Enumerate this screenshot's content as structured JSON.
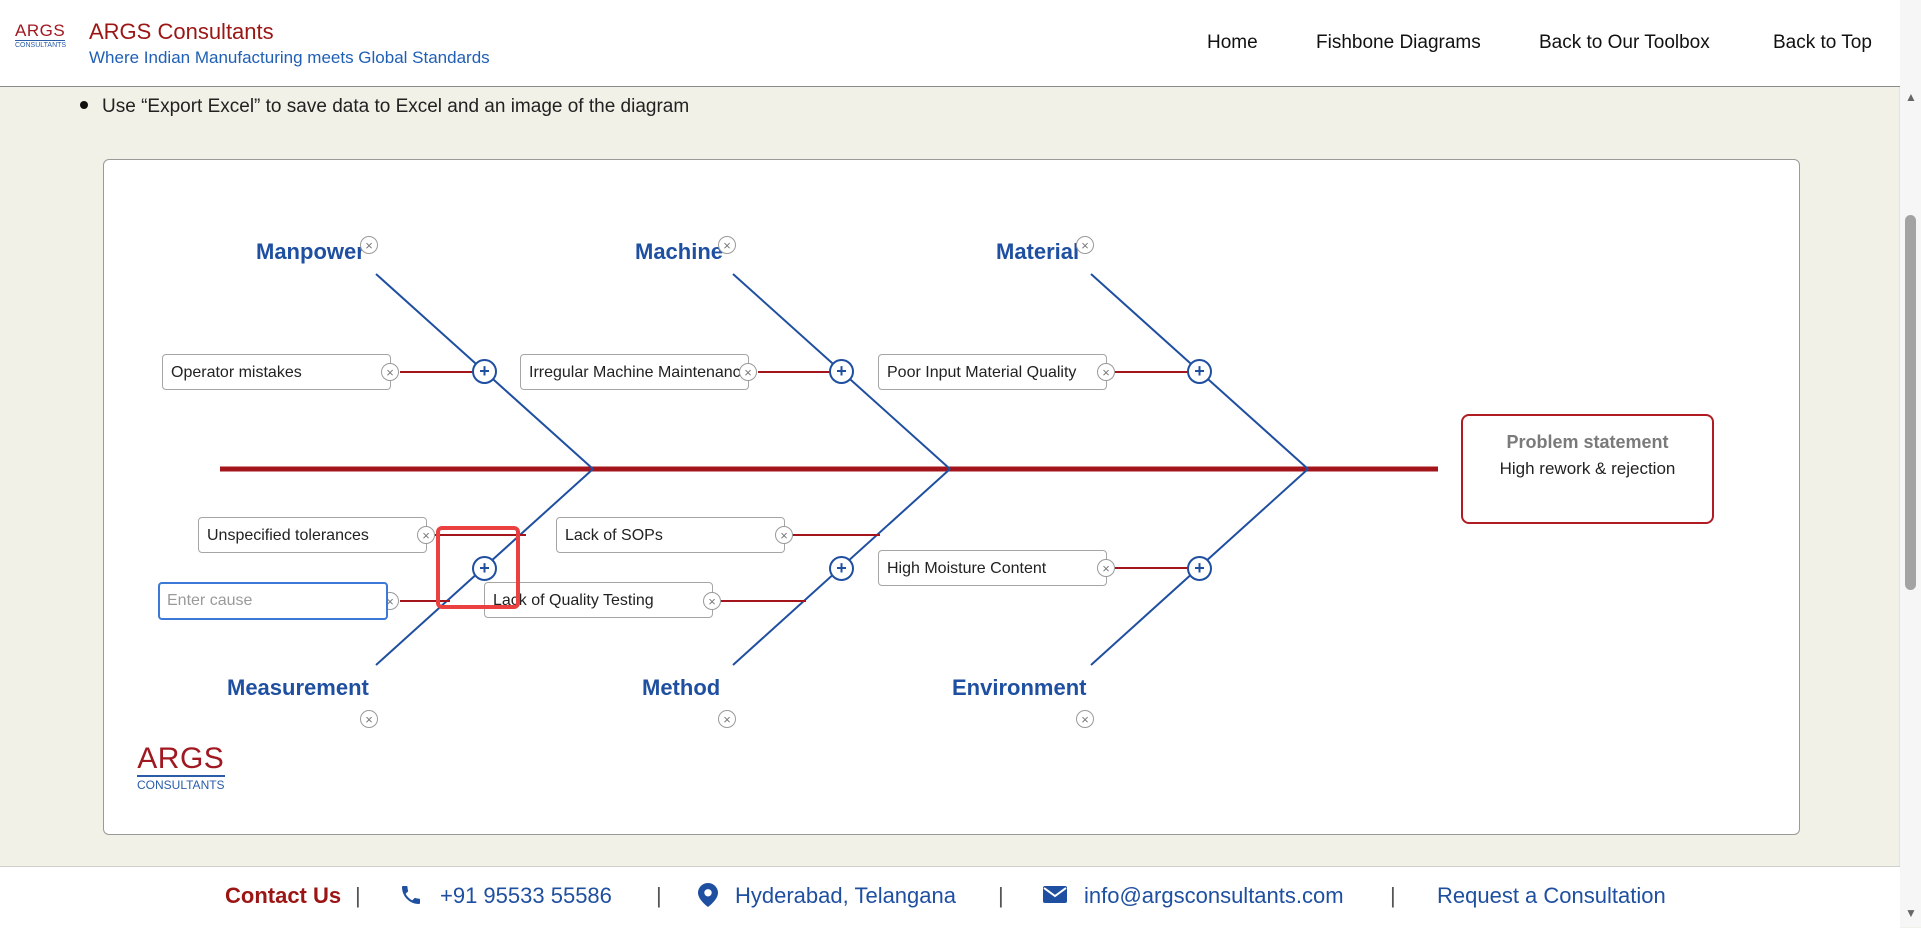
{
  "header": {
    "logo_top": "ARGS",
    "logo_bottom": "CONSULTANTS",
    "brand": "ARGS Consultants",
    "tagline": "Where Indian Manufacturing meets Global Standards",
    "nav": [
      "Home",
      "Fishbone Diagrams",
      "Back to Our Toolbox",
      "Back to Top"
    ]
  },
  "instructions": {
    "export_hint": "Use “Export Excel” to save data to Excel and an image of the diagram"
  },
  "diagram": {
    "categories": {
      "manpower": "Manpower",
      "machine": "Machine",
      "material": "Material",
      "measurement": "Measurement",
      "method": "Method",
      "environment": "Environment"
    },
    "causes": {
      "manpower_1": "Operator mistakes",
      "machine_1": "Irregular Machine Maintenance",
      "material_1": "Poor Input Material Quality",
      "measurement_1": "Unspecified tolerances",
      "method_1": "Lack of SOPs",
      "method_2": "Lack of Quality Testing",
      "environment_1": "High Moisture Content"
    },
    "new_cause_placeholder": "Enter cause",
    "problem_title": "Problem statement",
    "problem_text": "High rework & rejection",
    "watermark_top": "ARGS",
    "watermark_bottom": "CONSULTANTS",
    "icons": {
      "delete": "×",
      "add": "+"
    },
    "colors": {
      "spine": "#a3141b",
      "bone": "#1f4fa0",
      "twig": "#a3141b"
    }
  },
  "footer": {
    "contact": "Contact Us",
    "separator": "|",
    "phone": "+91 95533 55586",
    "location": "Hyderabad, Telangana",
    "email": "info@argsconsultants.com",
    "request": "Request a Consultation"
  }
}
